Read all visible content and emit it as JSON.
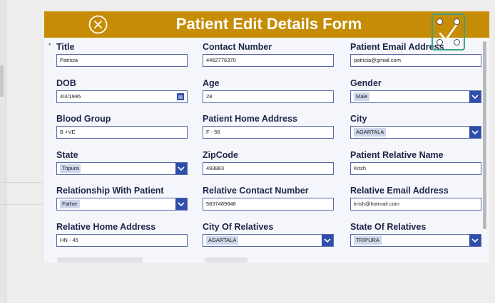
{
  "header": {
    "title": "Patient Edit Details Form",
    "bg_color": "#c68c06",
    "close_icon": "circle-x-icon",
    "submit_icon": "checkmark-icon"
  },
  "required_marker": "*",
  "fields": [
    {
      "label": "Title",
      "value": "Patricia",
      "type": "text"
    },
    {
      "label": "Contact Number",
      "value": "4462776370",
      "type": "text"
    },
    {
      "label": "Patient Email Address",
      "value": "patricia@gmail.com",
      "type": "text"
    },
    {
      "label": "DOB",
      "value": "4/4/1995",
      "type": "date"
    },
    {
      "label": "Age",
      "value": "28",
      "type": "text"
    },
    {
      "label": "Gender",
      "value": "Male",
      "type": "select"
    },
    {
      "label": "Blood Group",
      "value": "B +VE",
      "type": "text"
    },
    {
      "label": "Patient Home Address",
      "value": "F - 56",
      "type": "text"
    },
    {
      "label": "City",
      "value": "AGARTALA",
      "type": "select"
    },
    {
      "label": "State",
      "value": "Tripura",
      "type": "select"
    },
    {
      "label": "ZipCode",
      "value": "493883",
      "type": "text"
    },
    {
      "label": "Patient Relative Name",
      "value": "Krish",
      "type": "text"
    },
    {
      "label": "Relationship With Patient",
      "value": "Father",
      "type": "select"
    },
    {
      "label": "Relative Contact Number",
      "value": "5837489848",
      "type": "text"
    },
    {
      "label": "Relative Email Address",
      "value": "krish@hotmail.com",
      "type": "text"
    },
    {
      "label": "Relative Home Address",
      "value": "HN - 45",
      "type": "text"
    },
    {
      "label": "City Of Relatives",
      "value": "AGARTALA",
      "type": "select"
    },
    {
      "label": "State Of Relatives",
      "value": "TRIPURA",
      "type": "select"
    }
  ],
  "colors": {
    "accent": "#c68c06",
    "label": "#1b2648",
    "input_border": "#5268a8",
    "dropdown_button": "#2f4eaa",
    "selection_border": "#3aa487"
  }
}
